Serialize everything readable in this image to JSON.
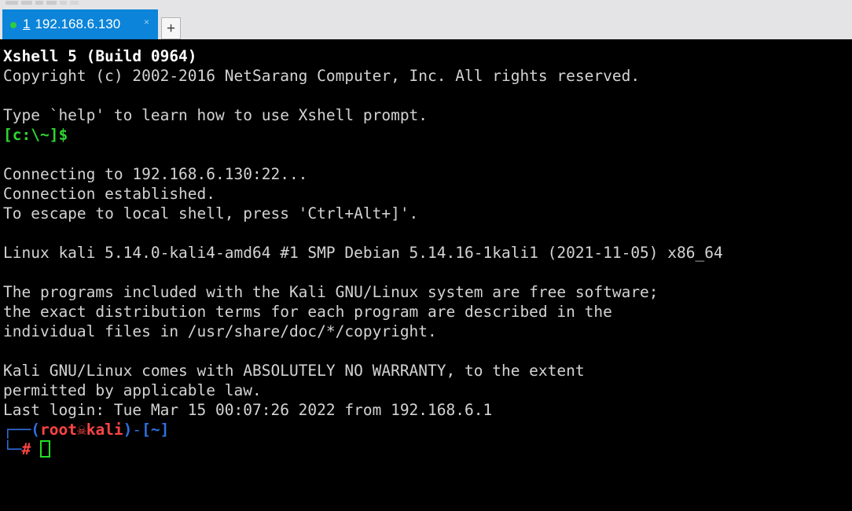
{
  "window": {
    "app_name": "Xshell 5"
  },
  "tabbar": {
    "tab": {
      "index": "1",
      "title": "192.168.6.130",
      "close_label": "×",
      "status_icon": "connected-dot-icon"
    },
    "new_tab_label": "+"
  },
  "terminal": {
    "lines": [
      {
        "id": "l01",
        "text": "Xshell 5 (Build 0964)",
        "style": "c-white"
      },
      {
        "id": "l02",
        "text": "Copyright (c) 2002-2016 NetSarang Computer, Inc. All rights reserved.",
        "style": "c-fg"
      },
      {
        "id": "l03",
        "text": "",
        "style": "blank"
      },
      {
        "id": "l04",
        "text": "Type `help' to learn how to use Xshell prompt.",
        "style": "c-fg"
      },
      {
        "id": "l05",
        "text": "[c:\\~]$",
        "style": "c-green"
      },
      {
        "id": "l06",
        "text": "",
        "style": "blank"
      },
      {
        "id": "l07",
        "text": "Connecting to 192.168.6.130:22...",
        "style": "c-fg"
      },
      {
        "id": "l08",
        "text": "Connection established.",
        "style": "c-fg"
      },
      {
        "id": "l09",
        "text": "To escape to local shell, press 'Ctrl+Alt+]'.",
        "style": "c-fg"
      },
      {
        "id": "l10",
        "text": "",
        "style": "blank"
      },
      {
        "id": "l11",
        "text": "Linux kali 5.14.0-kali4-amd64 #1 SMP Debian 5.14.16-1kali1 (2021-11-05) x86_64",
        "style": "c-fg"
      },
      {
        "id": "l12",
        "text": "",
        "style": "blank"
      },
      {
        "id": "l13",
        "text": "The programs included with the Kali GNU/Linux system are free software;",
        "style": "c-fg"
      },
      {
        "id": "l14",
        "text": "the exact distribution terms for each program are described in the",
        "style": "c-fg"
      },
      {
        "id": "l15",
        "text": "individual files in /usr/share/doc/*/copyright.",
        "style": "c-fg"
      },
      {
        "id": "l16",
        "text": "",
        "style": "blank"
      },
      {
        "id": "l17",
        "text": "Kali GNU/Linux comes with ABSOLUTELY NO WARRANTY, to the extent",
        "style": "c-fg"
      },
      {
        "id": "l18",
        "text": "permitted by applicable law.",
        "style": "c-fg"
      },
      {
        "id": "l19",
        "text": "Last login: Tue Mar 15 00:07:26 2022 from 192.168.6.1",
        "style": "c-fg"
      }
    ],
    "prompt": {
      "line1_corner": "┌──",
      "paren_open": "(",
      "user": "root",
      "skull": "☠",
      "host": "kali",
      "paren_close": ")",
      "dash": "-",
      "bracket_open": "[",
      "cwd": "~",
      "bracket_close": "]",
      "line2_corner": "└─",
      "sigil": "#",
      "input_value": ""
    }
  },
  "colors": {
    "tab_active_bg": "#0b84d9",
    "tabbar_bg": "#e4e4e6",
    "terminal_bg": "#000000",
    "terminal_fg": "#d3d3d3",
    "prompt_green": "#2fd42f",
    "kali_red": "#ff4444",
    "kali_blue": "#2f6fe0",
    "cursor_green": "#22e022",
    "status_dot_green": "#2ecc40"
  }
}
